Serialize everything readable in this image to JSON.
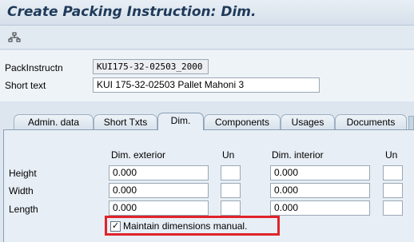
{
  "window": {
    "title": "Create Packing Instruction: Dim."
  },
  "toolbar": {
    "icon": "hierarchy-icon"
  },
  "header": {
    "packinstr_label": "PackInstructn",
    "packinstr_value": "KUI175-32-02503_2000",
    "shorttext_label": "Short text",
    "shorttext_value": "KUI 175-32-02503 Pallet Mahoni 3"
  },
  "tabs": [
    {
      "label": "Admin. data"
    },
    {
      "label": "Short Txts"
    },
    {
      "label": "Dim."
    },
    {
      "label": "Components"
    },
    {
      "label": "Usages"
    },
    {
      "label": "Documents"
    }
  ],
  "active_tab": "Dim.",
  "dims": {
    "exterior_header": "Dim. exterior",
    "unit_header": "Un",
    "interior_header": "Dim. interior",
    "unit_header2": "Un",
    "rows": [
      {
        "label": "Height",
        "exterior": "0.000",
        "ext_unit": "",
        "interior": "0.000",
        "int_unit": ""
      },
      {
        "label": "Width",
        "exterior": "0.000",
        "ext_unit": "",
        "interior": "0.000",
        "int_unit": ""
      },
      {
        "label": "Length",
        "exterior": "0.000",
        "ext_unit": "",
        "interior": "0.000",
        "int_unit": ""
      }
    ],
    "maintain_manual_label": "Maintain dimensions manual.",
    "maintain_manual_checked": true,
    "checkmark": "✓"
  },
  "colors": {
    "highlight": "#e0242a"
  }
}
